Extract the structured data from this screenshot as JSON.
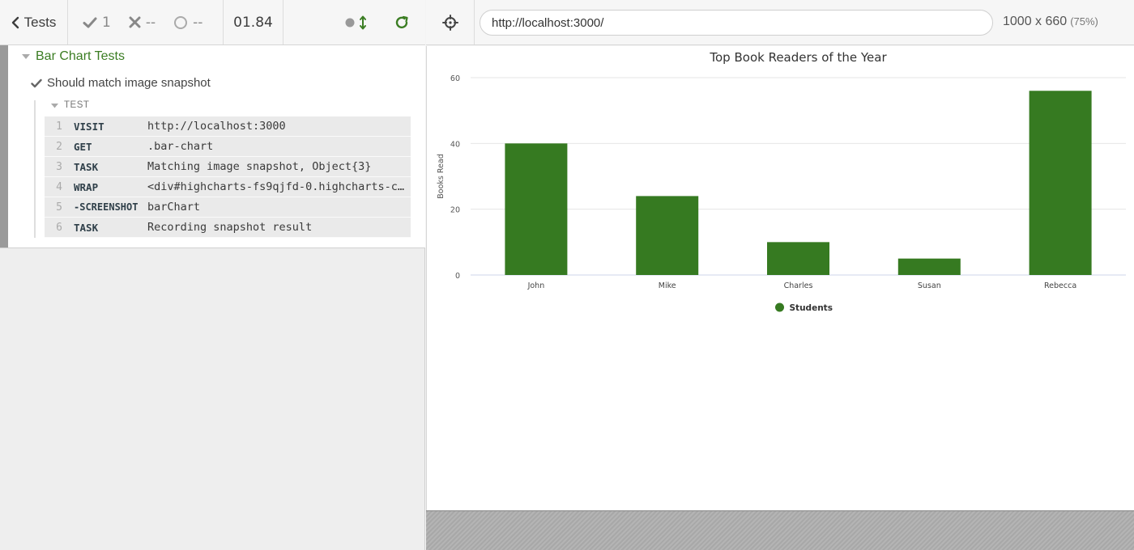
{
  "reporter": {
    "tests_button": "Tests",
    "passed_count": "1",
    "failed_count": "--",
    "pending_count": "--",
    "duration": "01.84",
    "suite_title": "Bar Chart Tests",
    "test_title": "Should match image snapshot",
    "block_label": "TEST",
    "commands": [
      {
        "num": "1",
        "name": "VISIT",
        "message": "http://localhost:3000",
        "child": false
      },
      {
        "num": "2",
        "name": "GET",
        "message": ".bar-chart",
        "child": false
      },
      {
        "num": "3",
        "name": "TASK",
        "message": "Matching image snapshot, Object{3}",
        "child": false
      },
      {
        "num": "4",
        "name": "WRAP",
        "message": "<div#highcharts-fs9qjfd-0.highcharts-container>",
        "child": false
      },
      {
        "num": "5",
        "name": "-SCREENSHOT",
        "message": "barChart",
        "child": true
      },
      {
        "num": "6",
        "name": "TASK",
        "message": "Recording snapshot result",
        "child": false
      }
    ]
  },
  "aut": {
    "url": "http://localhost:3000/",
    "viewport_size": "1000 x 660",
    "viewport_scale": "(75%)"
  },
  "colors": {
    "accent_green": "#3b7d23",
    "bar_green": "#367a21"
  },
  "chart_data": {
    "type": "bar",
    "title": "Top Book Readers of the Year",
    "ylabel": "Books Read",
    "xlabel": "",
    "categories": [
      "John",
      "Mike",
      "Charles",
      "Susan",
      "Rebecca"
    ],
    "series": [
      {
        "name": "Students",
        "values": [
          40,
          24,
          10,
          5,
          56
        ]
      }
    ],
    "ylim": [
      0,
      60
    ],
    "yticks": [
      0,
      20,
      40,
      60
    ],
    "grid": true,
    "legend": "bottom-center"
  }
}
